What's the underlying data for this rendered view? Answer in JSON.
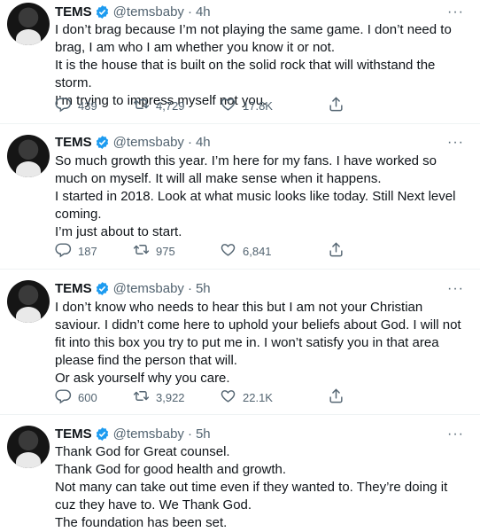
{
  "tweets": [
    {
      "name": "TEMS",
      "handle": "@temsbaby",
      "dot": "·",
      "time": "4h",
      "more": "···",
      "lines": [
        "I don’t brag because I’m not playing the same game. I don’t need to brag, I am who I am whether you know it or not.",
        "It is the house that is built on the solid rock that will withstand the storm.",
        "I’m trying to impress myself not you."
      ],
      "replies": "439",
      "retweets": "4,729",
      "likes": "17.8K"
    },
    {
      "name": "TEMS",
      "handle": "@temsbaby",
      "dot": "·",
      "time": "4h",
      "more": "···",
      "lines": [
        "So much growth this year. I’m here for my fans. I have worked so much on myself. It will all make sense when it happens.",
        "I started in 2018. Look at what music looks like today. Still Next level coming.",
        "I’m just about to start."
      ],
      "replies": "187",
      "retweets": "975",
      "likes": "6,841"
    },
    {
      "name": "TEMS",
      "handle": "@temsbaby",
      "dot": "·",
      "time": "5h",
      "more": "···",
      "lines": [
        "I don’t know who needs to hear this but I am not your Christian saviour. I didn’t come here to uphold your beliefs about God. I will not fit into this box you try to put me in. I won’t satisfy you in that area please find the person that will.",
        "Or ask yourself why you care."
      ],
      "replies": "600",
      "retweets": "3,922",
      "likes": "22.1K"
    },
    {
      "name": "TEMS",
      "handle": "@temsbaby",
      "dot": "·",
      "time": "5h",
      "more": "···",
      "lines": [
        "Thank God for Great counsel.",
        "Thank God for good health and growth.",
        "Not many can take out time even if they wanted to. They’re doing it cuz they have to. We Thank God.",
        "The foundation has been set."
      ]
    }
  ],
  "icons": {
    "reply": "reply-icon",
    "retweet": "retweet-icon",
    "like": "like-icon",
    "share": "share-icon",
    "verified": "verified-badge-icon"
  },
  "colors": {
    "verified": "#1d9bf0",
    "text": "#0f1419",
    "muted": "#536471"
  }
}
